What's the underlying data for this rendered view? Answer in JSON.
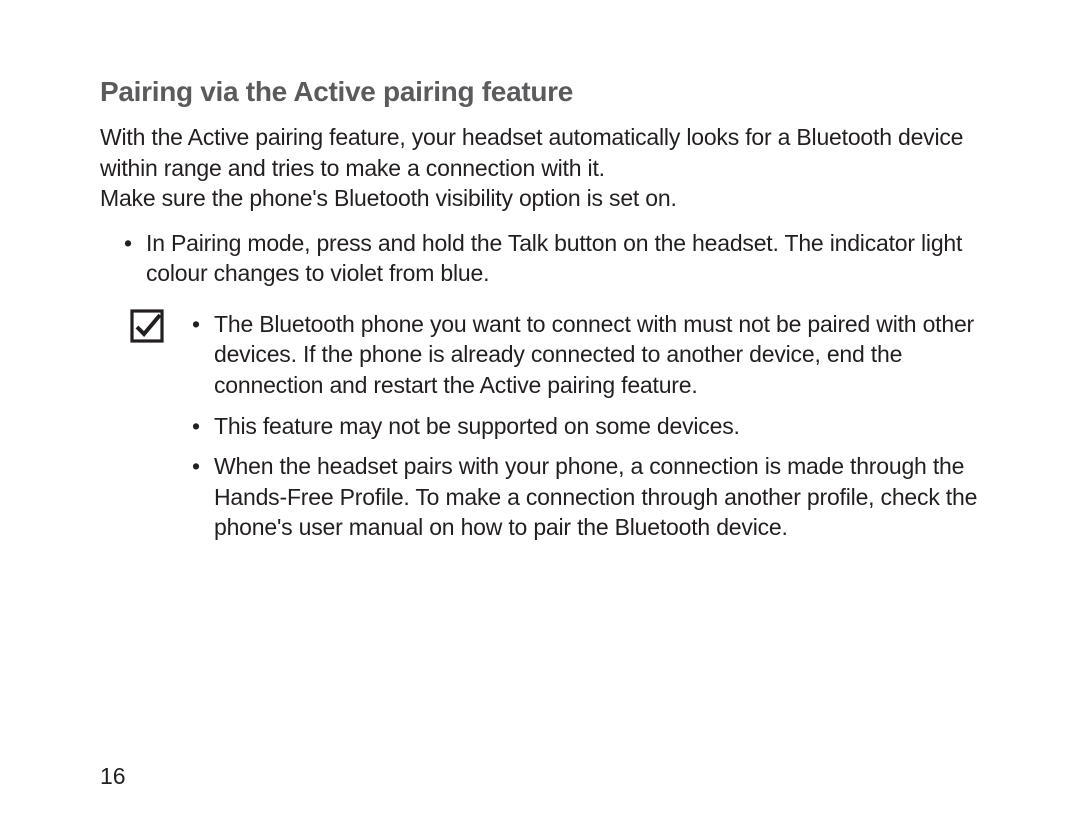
{
  "heading": "Pairing via the Active pairing feature",
  "intro_line1": "With the Active pairing feature, your headset automatically looks for a Bluetooth device within range and tries to make a connection with it.",
  "intro_line2": "Make sure the phone's Bluetooth visibility option is set on.",
  "primary_bullets": [
    "In Pairing mode, press and hold the Talk button on the headset. The indicator light colour changes to violet from blue."
  ],
  "note_bullets": [
    "The Bluetooth phone you want to connect with must not be paired with other devices. If the phone is already connected to another device, end the connection and restart the Active pairing feature.",
    "This feature may not be supported on some devices.",
    "When the headset pairs with your phone, a connection is made through the Hands-Free Profile. To make a connection through another profile, check the phone's user manual on how to pair the Bluetooth device."
  ],
  "page_number": "16"
}
